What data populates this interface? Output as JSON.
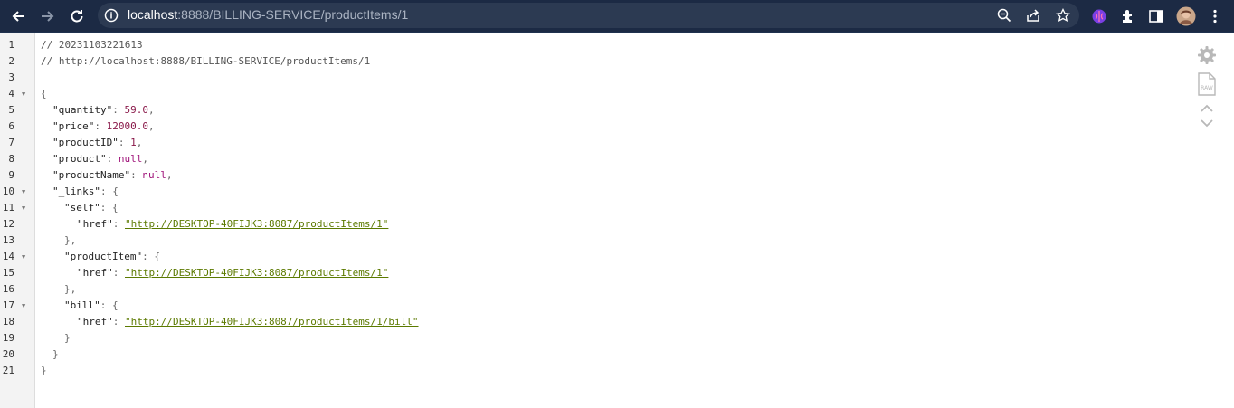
{
  "browser": {
    "url_host": "localhost",
    "url_path": ":8888/BILLING-SERVICE/productItems/1",
    "icons": [
      "back-icon",
      "forward-icon",
      "reload-icon",
      "info-icon",
      "zoom-icon",
      "share-icon",
      "bookmark-star-icon",
      "extension-brain-icon",
      "extensions-puzzle-icon",
      "side-panel-icon",
      "profile-avatar",
      "menu-dots-icon"
    ]
  },
  "viewer": {
    "line_numbers": [
      "1",
      "2",
      "3",
      "4",
      "5",
      "6",
      "7",
      "8",
      "9",
      "10",
      "11",
      "12",
      "13",
      "14",
      "15",
      "16",
      "17",
      "18",
      "19",
      "20",
      "21"
    ],
    "comment_1": "// 20231103221613",
    "comment_2": "// http://localhost:8888/BILLING-SERVICE/productItems/1",
    "open_brace": "{",
    "close_brace": "}",
    "fields": {
      "quantity_key": "\"quantity\"",
      "quantity_val": "59.0",
      "price_key": "\"price\"",
      "price_val": "12000.0",
      "productID_key": "\"productID\"",
      "productID_val": "1",
      "product_key": "\"product\"",
      "product_val": "null",
      "productName_key": "\"productName\"",
      "productName_val": "null",
      "links_key": "\"_links\"",
      "self_key": "\"self\"",
      "href_key": "\"href\"",
      "self_href": "\"http://DESKTOP-40FIJK3:8087/productItems/1\"",
      "productItem_key": "\"productItem\"",
      "productItem_href": "\"http://DESKTOP-40FIJK3:8087/productItems/1\"",
      "bill_key": "\"bill\"",
      "bill_href": "\"http://DESKTOP-40FIJK3:8087/productItems/1/bill\""
    },
    "side_icons": [
      "gear-icon",
      "raw-file-icon",
      "collapse-expand-icon"
    ],
    "raw_label": "RAW"
  }
}
